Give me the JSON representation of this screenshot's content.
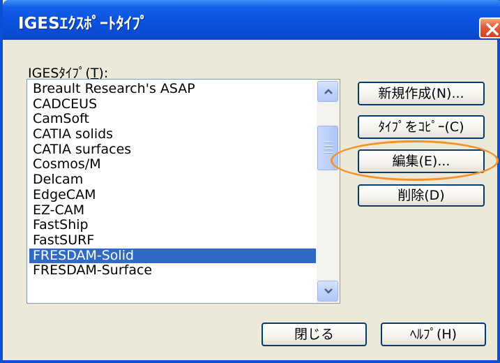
{
  "window": {
    "title": "IGESｴｸｽﾎﾟｰﾄﾀｲﾌﾟ",
    "close_icon": "close-icon",
    "accent_color": "#0a4fd6",
    "close_color": "#d0421c"
  },
  "list": {
    "label_prefix": "IGESﾀｲﾌﾟ(",
    "label_mnemonic": "T",
    "label_suffix": "):",
    "items": [
      "Breault Research's ASAP",
      "CADCEUS",
      "CamSoft",
      "CATIA solids",
      "CATIA surfaces",
      "Cosmos/M",
      "Delcam",
      "EdgeCAM",
      "EZ-CAM",
      "FastShip",
      "FastSURF",
      "FRESDAM-Solid",
      "FRESDAM-Surface"
    ],
    "selected_index": 11,
    "selection_color": "#316ac5"
  },
  "buttons": {
    "new": "新規作成(N)...",
    "copy": "ﾀｲﾌﾟをｺﾋﾟｰ(C)",
    "edit": "編集(E)...",
    "delete": "削除(D)",
    "close": "閉じる",
    "help": "ﾍﾙﾌﾟ(H)"
  },
  "annotation": {
    "highlight_color": "#f3922b",
    "target": "edit"
  }
}
